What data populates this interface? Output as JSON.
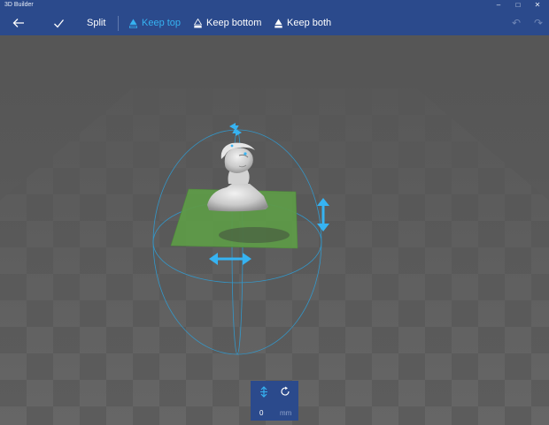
{
  "window": {
    "title": "3D Builder",
    "minimize_icon": "minimize-icon",
    "maximize_icon": "maximize-icon",
    "close_icon": "close-icon"
  },
  "toolbar": {
    "back_icon": "back-arrow-icon",
    "confirm_icon": "checkmark-icon",
    "split_label": "Split",
    "keep_top_label": "Keep top",
    "keep_bottom_label": "Keep bottom",
    "keep_both_label": "Keep both",
    "active_option": "Keep top",
    "undo_icon": "undo-icon",
    "redo_icon": "redo-icon"
  },
  "panel": {
    "move_icon": "vertical-move-icon",
    "rotate_icon": "rotate-icon",
    "offset_value": "0",
    "unit": "mm"
  },
  "colors": {
    "accent": "#36b3f2",
    "toolbar_bg": "#2b4a8c",
    "cut_plane": "#5e9a48"
  }
}
